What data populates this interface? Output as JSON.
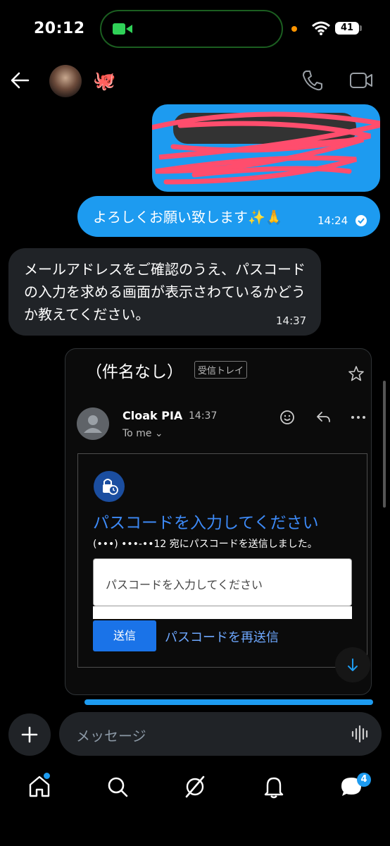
{
  "status_bar": {
    "time": "20:12",
    "battery": "41"
  },
  "header": {
    "contact_emoji": "🐙",
    "icons": [
      "back-arrow-icon",
      "phone-icon",
      "video-icon"
    ]
  },
  "messages": {
    "sent_text": "よろしくお願い致します✨🙏",
    "sent_time": "14:24",
    "received_text": "メールアドレスをご確認のうえ、パスコードの入力を求める画面が表示さわているかどうか教えてください。",
    "received_time": "14:37"
  },
  "email": {
    "subject": "（件名なし）",
    "folder_tag": "受信トレイ",
    "sender": "Cloak PIA",
    "time": "14:37",
    "to": "To me ⌄",
    "title": "パスコードを入力してください",
    "sent_line": "(•••) •••-••12 宛にパスコードを送信しました。",
    "input_placeholder": "パスコードを入力してください",
    "send_button": "送信",
    "resend_link": "パスコードを再送信"
  },
  "composer": {
    "placeholder": "メッセージ"
  },
  "tabs": {
    "messages_badge": "4"
  },
  "colors": {
    "accent": "#1d9bf0",
    "received_bubble": "#202327",
    "link": "#6ea8ff"
  }
}
